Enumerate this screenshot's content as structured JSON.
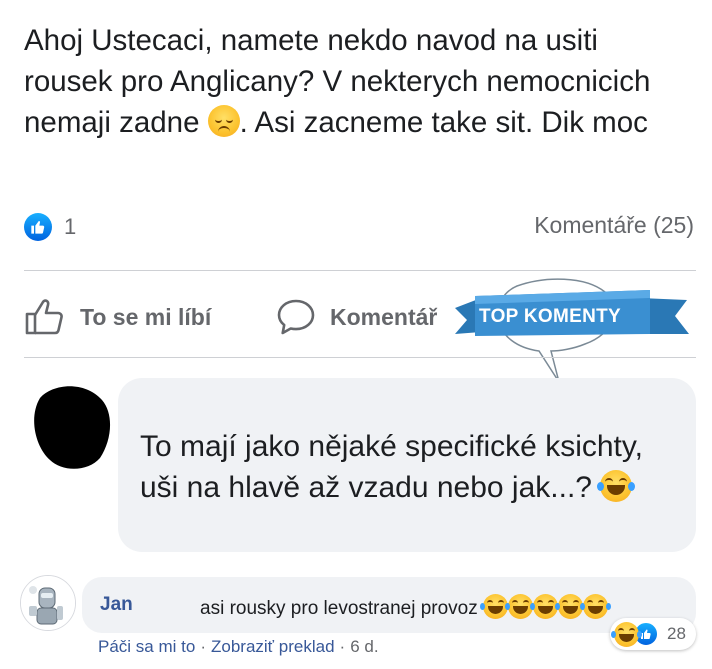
{
  "post": {
    "text_before_emoji": "Ahoj Ustecaci, namete nekdo navod na usiti rousek pro Anglicany? V nekterych nemocnicich nemaji zadne ",
    "text_after_emoji": ". Asi zacneme take sit. Dik moc",
    "like_count": "1",
    "comments_label": "Komentáře (25)"
  },
  "actions": {
    "like_label": "To se mi líbí",
    "comment_label": "Komentář"
  },
  "badge": {
    "label": "TOP KOMENTY"
  },
  "top_comment": {
    "text": "To mají jako nějaké specifické ksichty, uši na hlavě až vzadu nebo jak...? "
  },
  "reply": {
    "author": "Jan",
    "text": "asi rousky pro levostranej provoz",
    "like_link": "Páči sa mi to",
    "translate_link": "Zobraziť preklad",
    "time": "6 d.",
    "reaction_count": "28"
  },
  "icons": {
    "sad": "disappointed-face-icon",
    "laugh": "tears-of-joy-icon",
    "thumb": "thumbs-up-icon",
    "comment": "speech-bubble-icon"
  },
  "colors": {
    "brand_blue": "#1877f2",
    "link_blue": "#385898",
    "badge_blue": "#2f86c6",
    "bubble_gray": "#f0f2f5"
  }
}
